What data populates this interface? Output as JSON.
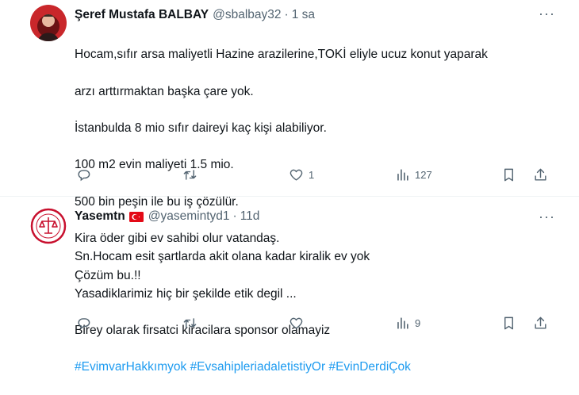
{
  "tweets": [
    {
      "name": "Şeref Mustafa BALBAY",
      "handle": "@sbalbay32",
      "dot": "·",
      "time": "1 sa",
      "more": "···",
      "lines": [
        "Hocam,sıfır arsa maliyetli Hazine arazilerine,TOKİ eliyle ucuz konut yaparak",
        "arzı arttırmaktan başka çare yok.",
        "İstanbulda 8 mio sıfır daireyi kaç kişi alabiliyor.",
        "100 m2 evin maliyeti 1.5 mio.",
        "500 bin peşin ile bu iş çözülür.",
        "Kira öder gibi ev sahibi olur vatandaş.",
        "Çözüm bu.!!"
      ],
      "actions": {
        "replies": "",
        "retweets": "",
        "likes": "1",
        "views": "127"
      }
    },
    {
      "name": "Yasemtn",
      "handle": "@yasemintyd1",
      "dot": "·",
      "time": "11d",
      "more": "···",
      "lines": [
        "Sn.Hocam esit şartlarda akit olana kadar kiralik ev yok",
        "Yasadiklarimiz hiç bir şekilde etik degil ...",
        "Birey olarak firsatci kiracilara sponsor olamayiz"
      ],
      "hashtags": [
        "#EvimvarHakkımyok",
        "#EvsahipleriadaletistiyOr",
        "#EvinDerdiÇok"
      ],
      "actions": {
        "replies": "",
        "retweets": "",
        "likes": "",
        "views": "9"
      }
    }
  ],
  "colors": {
    "text": "#0f1419",
    "secondary": "#536471",
    "link": "#1d9bf0",
    "divider": "#eff3f4",
    "flag_red": "#e30a17"
  },
  "icons": {
    "reply": "reply-icon",
    "retweet": "retweet-icon",
    "like": "heart-icon",
    "views": "views-icon",
    "bookmark": "bookmark-icon",
    "share": "share-icon",
    "flag": "turkey-flag-icon"
  }
}
